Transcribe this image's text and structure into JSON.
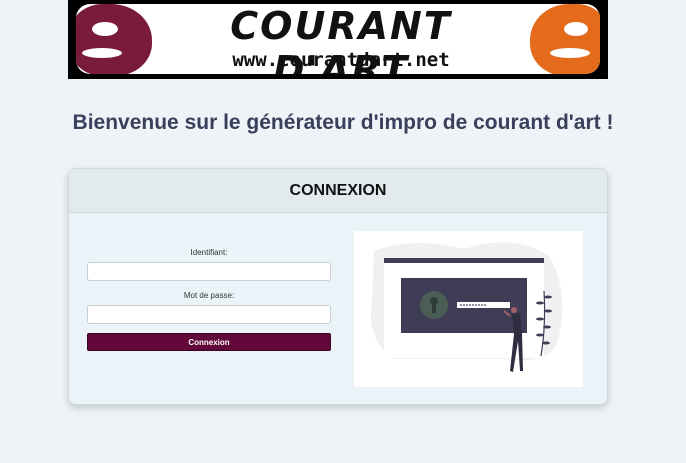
{
  "banner": {
    "title": "COURANT D'ART",
    "url": "www.courantdart.net",
    "colors": {
      "left_mask": "#7a1b3a",
      "right_mask": "#e46a1c"
    }
  },
  "welcome_text": "Bienvenue sur le générateur d'impro de courant d'art !",
  "login": {
    "title": "CONNEXION",
    "username_label": "Identifiant:",
    "username_value": "",
    "password_label": "Mot de passe:",
    "password_value": "",
    "submit_label": "Connexion",
    "illustration_icon": "person-unlocking-screen-illustration",
    "colors": {
      "button": "#62073a",
      "card": "#eaf4f8"
    }
  }
}
